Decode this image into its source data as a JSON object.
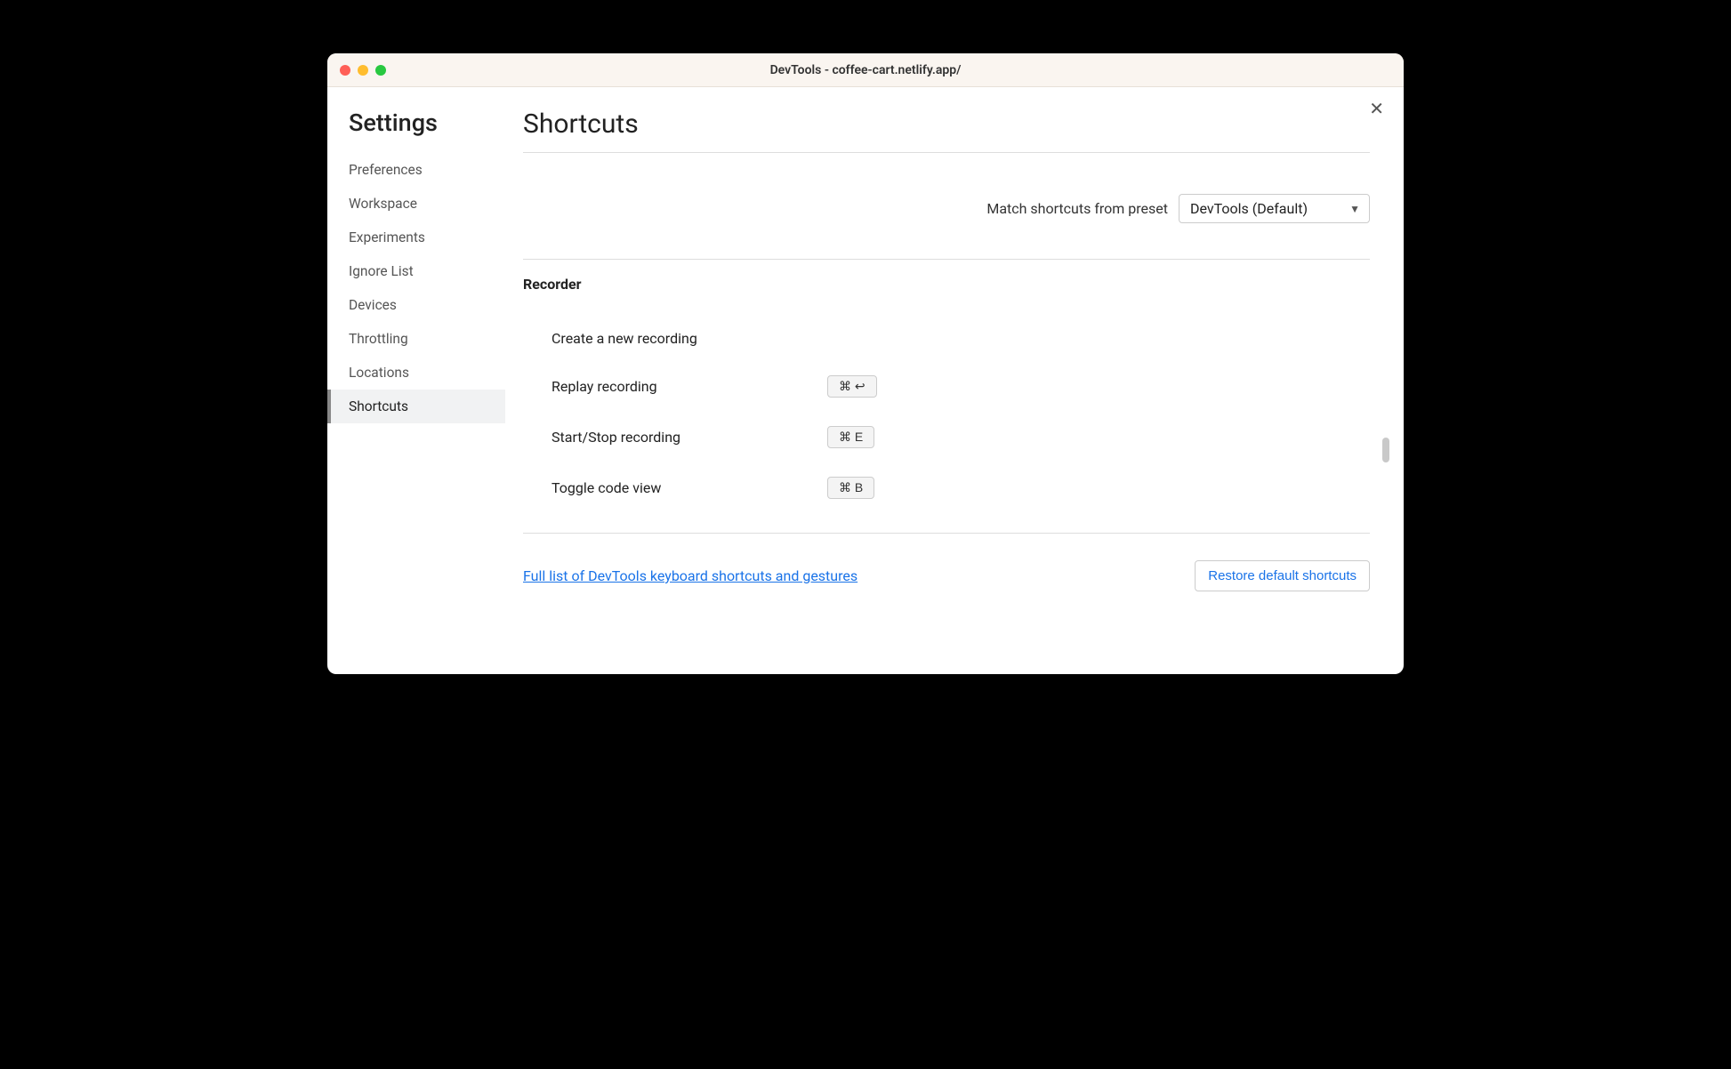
{
  "titlebar": {
    "title": "DevTools - coffee-cart.netlify.app/"
  },
  "sidebar": {
    "title": "Settings",
    "items": [
      {
        "label": "Preferences"
      },
      {
        "label": "Workspace"
      },
      {
        "label": "Experiments"
      },
      {
        "label": "Ignore List"
      },
      {
        "label": "Devices"
      },
      {
        "label": "Throttling"
      },
      {
        "label": "Locations"
      },
      {
        "label": "Shortcuts"
      }
    ]
  },
  "main": {
    "title": "Shortcuts",
    "preset_label": "Match shortcuts from preset",
    "preset_value": "DevTools (Default)",
    "section_title": "Recorder",
    "shortcuts": [
      {
        "label": "Create a new recording",
        "keys": ""
      },
      {
        "label": "Replay recording",
        "keys": "⌘ ↩"
      },
      {
        "label": "Start/Stop recording",
        "keys": "⌘ E"
      },
      {
        "label": "Toggle code view",
        "keys": "⌘ B"
      }
    ],
    "full_list_link": "Full list of DevTools keyboard shortcuts and gestures",
    "restore_button": "Restore default shortcuts"
  }
}
